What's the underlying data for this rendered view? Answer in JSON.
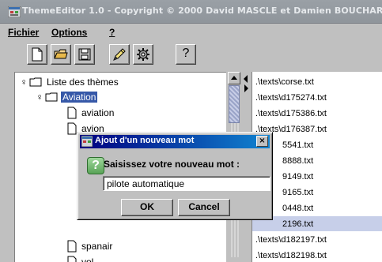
{
  "window": {
    "title": "ThemeEditor 1.0 - Copyright © 2000 David MASCLE et Damien BOUCHAR"
  },
  "menubar": {
    "items": [
      "Fichier",
      "Options",
      "?"
    ]
  },
  "toolbar": {
    "buttons": [
      "new-file-icon",
      "open-folder-icon",
      "save-disk-icon",
      "edit-pencil-icon",
      "settings-gear-icon",
      "help-question-icon"
    ],
    "help_label": "?"
  },
  "tree": {
    "root": "Liste des thèmes",
    "selected": "Aviation",
    "items": [
      "aviation",
      "avion",
      "spanair",
      "vol"
    ]
  },
  "filelist": {
    "items": [
      ".\\texts\\corse.txt",
      ".\\texts\\d175274.txt",
      ".\\texts\\d175386.txt",
      ".\\texts\\d176387.txt",
      "5541.txt",
      "8888.txt",
      "9149.txt",
      "9165.txt",
      "0448.txt",
      "2196.txt",
      ".\\texts\\d182197.txt",
      ".\\texts\\d182198.txt"
    ],
    "selected_index": 9
  },
  "dialog": {
    "title": "Ajout d'un nouveau mot",
    "close_label": "×",
    "icon_label": "?",
    "prompt": "Saisissez votre nouveau mot :",
    "input_value": "pilote automatique",
    "ok_label": "OK",
    "cancel_label": "Cancel"
  },
  "colors": {
    "selection": "#3658a8",
    "dialog_title": "#000080",
    "question_icon": "#59a457"
  }
}
